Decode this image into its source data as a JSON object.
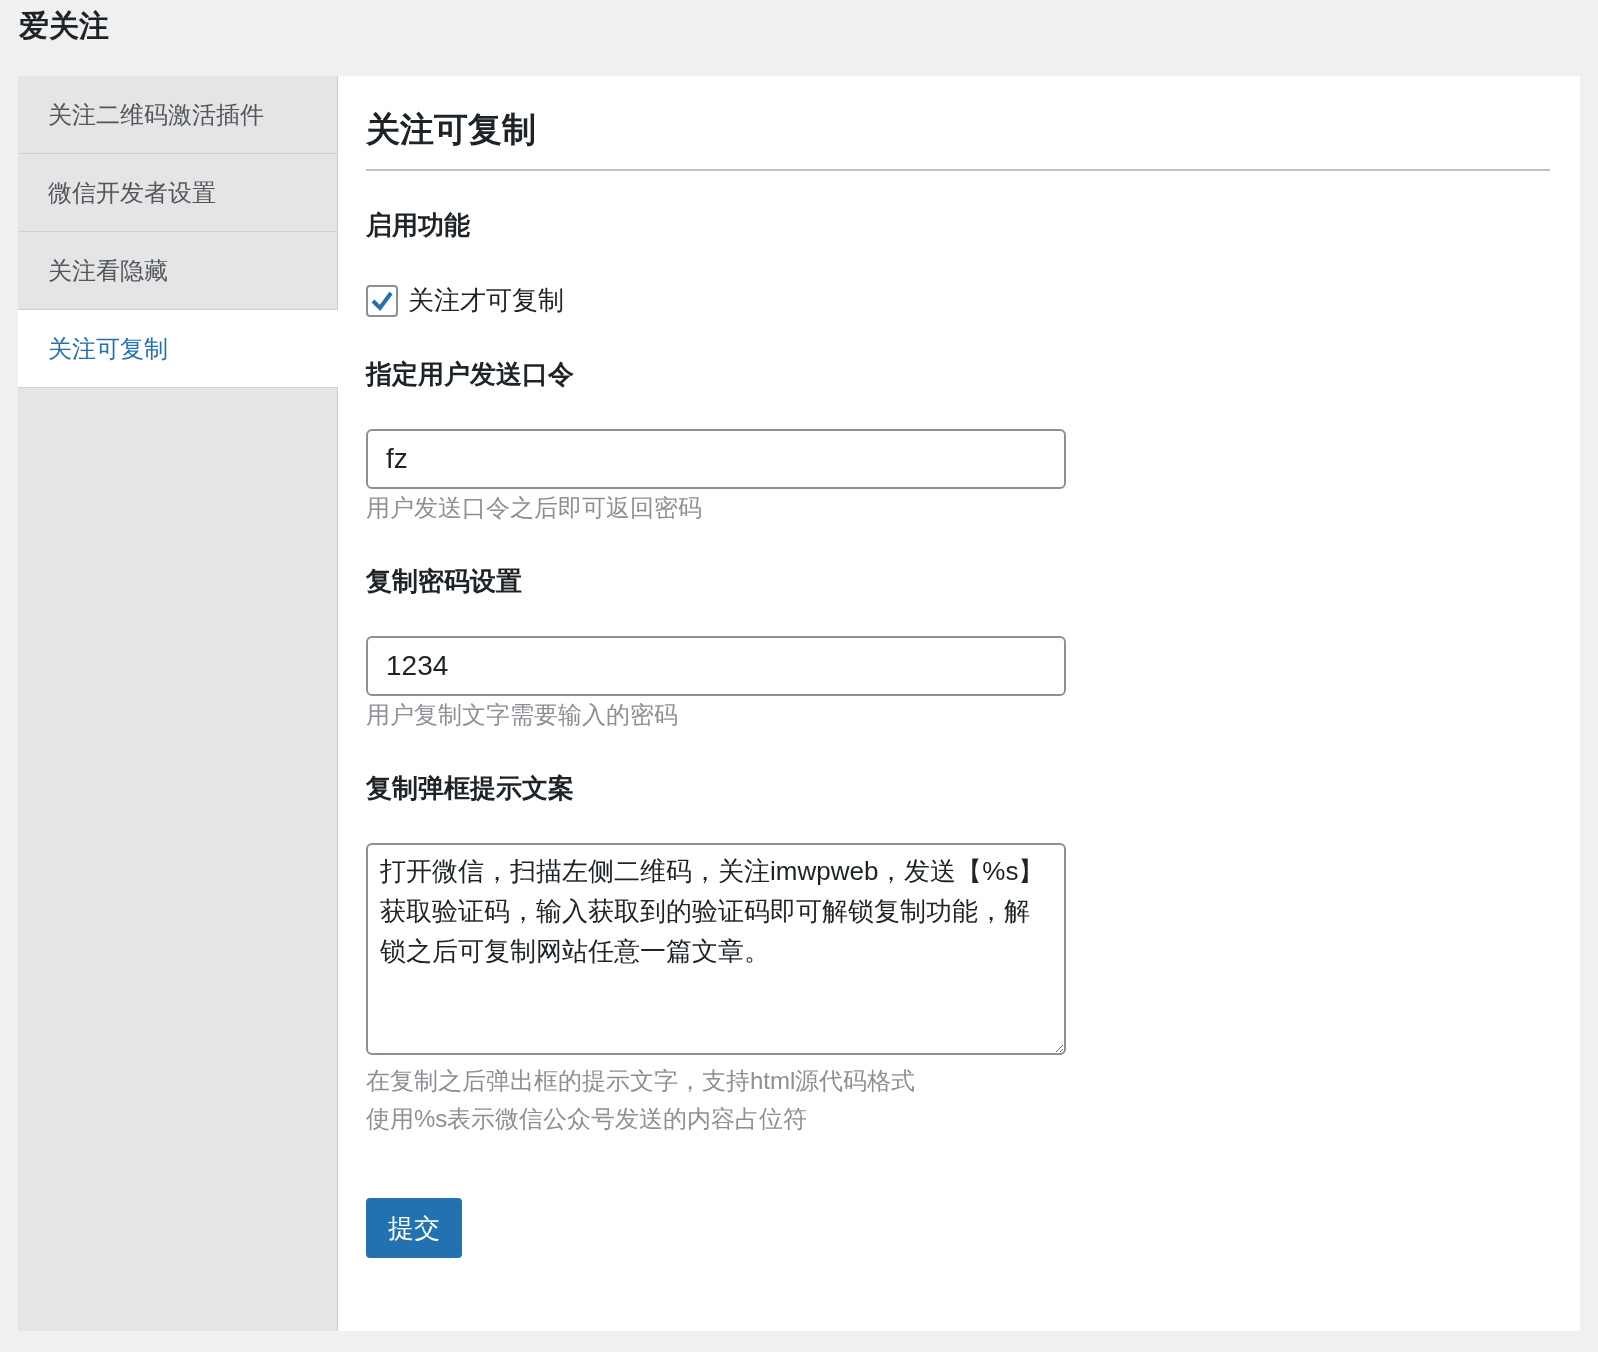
{
  "page_title": "爱关注",
  "sidebar": {
    "items": [
      {
        "label": "关注二维码激活插件",
        "selected": false
      },
      {
        "label": "微信开发者设置",
        "selected": false
      },
      {
        "label": "关注看隐藏",
        "selected": false
      },
      {
        "label": "关注可复制",
        "selected": true
      }
    ]
  },
  "content": {
    "heading": "关注可复制",
    "sections": [
      {
        "kind": "checkbox",
        "title": "启用功能",
        "label": "关注才可复制",
        "checked": true
      },
      {
        "kind": "input",
        "title": "指定用户发送口令",
        "value": "fz",
        "hints": [
          "用户发送口令之后即可返回密码"
        ]
      },
      {
        "kind": "input",
        "title": "复制密码设置",
        "value": "1234",
        "hints": [
          "用户复制文字需要输入的密码"
        ]
      },
      {
        "kind": "textarea",
        "title": "复制弹框提示文案",
        "value": "打开微信，扫描左侧二维码，关注imwpweb，发送【%s】获取验证码，输入获取到的验证码即可解锁复制功能，解锁之后可复制网站任意一篇文章。",
        "hints": [
          "在复制之后弹出框的提示文字，支持html源代码格式",
          "使用%s表示微信公众号发送的内容占位符"
        ]
      }
    ],
    "submit": "提交"
  }
}
